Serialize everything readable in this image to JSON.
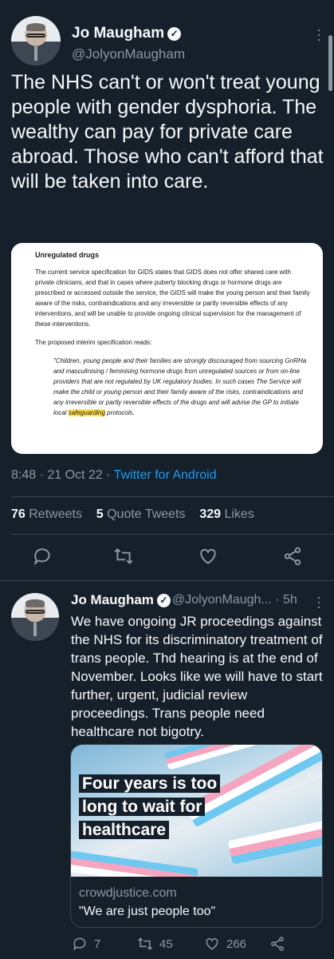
{
  "main_tweet": {
    "author": "Jo Maugham",
    "handle": "@JolyonMaugham",
    "text": "The NHS can't or won't treat young people with gender dysphoria. The wealthy can pay for private care abroad. Those who can't afford that will be taken into care.",
    "document": {
      "heading": "Unregulated drugs",
      "para1": "The current service specification for GIDS states that GIDS does not offer shared care with private clinicians, and that in cases where puberty blocking drugs or hormone drugs are prescribed or accessed outside the service, the GIDS will make the young person and their family aware of the risks, contraindications and any irreversible or partly reversible effects of any interventions, and will be unable to provide ongoing clinical supervision for the management of these interventions.",
      "para2": "The proposed interim specification reads:",
      "quote_before": "\"Children, young people and their families are strongly discouraged from sourcing GnRHa and masculinising / feminising hormone drugs from unregulated sources or from on-line providers that are not regulated by UK regulatory bodies. In such cases The Service will make the child or young person and their family aware of the risks, contraindications and any irreversible or partly reversible effects of the drugs and will advise the GP to initiate local ",
      "quote_highlight": "safeguarding",
      "quote_after": " protocols."
    },
    "time": "8:48 · 21 Oct 22 · ",
    "source": "Twitter for Android",
    "retweets_count": "76",
    "retweets_label": "Retweets",
    "quote_count": "5",
    "quote_label": "Quote Tweets",
    "likes_count": "329",
    "likes_label": "Likes"
  },
  "reply_tweet": {
    "author": "Jo Maugham",
    "handle_time": "@JolyonMaugh... · 5h",
    "text": "We have ongoing JR proceedings against the NHS for its discriminatory treatment of trans people. Thd hearing is at the end of November. Looks like we will have to start further, urgent, judicial review proceedings. Trans people need healthcare not bigotry.",
    "card": {
      "headline": "Four years is too long to wait for healthcare",
      "domain": "crowdjustice.com",
      "title": "\"We are just people too\""
    },
    "replies": "7",
    "retweets": "45",
    "likes": "266"
  },
  "icons": [
    "verified-icon",
    "more-icon",
    "reply-icon",
    "retweet-icon",
    "like-icon",
    "share-icon"
  ],
  "colors": {
    "background": "#15202b",
    "accent": "#1d9bf0",
    "muted": "#8b98a5",
    "highlight": "#ffe04b"
  }
}
